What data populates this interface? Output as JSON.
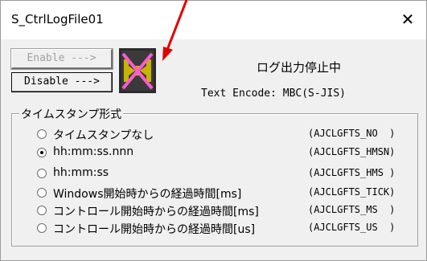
{
  "window": {
    "title": "S_CtrlLogFile01",
    "close_glyph": "✕"
  },
  "buttons": {
    "enable_label": "Enable --->",
    "disable_label": "Disable --->"
  },
  "status": {
    "text": "ログ出力停止中",
    "encode": "Text Encode: MBC(S-JIS)",
    "icon": "log-disabled-icon"
  },
  "timestamp_group": {
    "legend": "タイムスタンプ形式",
    "options": [
      {
        "label": "タイムスタンプなし",
        "code": "(AJCLGFTS_NO  )",
        "selected": false
      },
      {
        "label": "hh:mm:ss.nnn",
        "code": "(AJCLGFTS_HMSN)",
        "selected": true
      },
      {
        "label": "hh:mm:ss",
        "code": "(AJCLGFTS_HMS )",
        "selected": false
      },
      {
        "label": "Windows開始時からの経過時間[ms]",
        "code": "(AJCLGFTS_TICK)",
        "selected": false
      },
      {
        "label": "コントロール開始時からの経過時間[ms]",
        "code": "(AJCLGFTS_MS  )",
        "selected": false
      },
      {
        "label": "コントロール開始時からの経過時間[us]",
        "code": "(AJCLGFTS_US  )",
        "selected": false
      }
    ]
  },
  "colors": {
    "window_bg": "#f0f0f0",
    "arrow": "#e00000",
    "icon_bg": "#2b2b2b",
    "icon_fg": "#c8b400",
    "icon_x": "#ff5ad0"
  }
}
